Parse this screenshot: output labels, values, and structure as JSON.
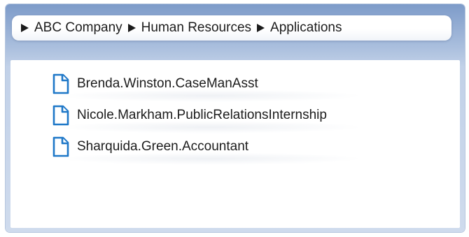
{
  "breadcrumb": {
    "items": [
      {
        "label": "ABC Company"
      },
      {
        "label": "Human Resources"
      },
      {
        "label": "Applications"
      }
    ]
  },
  "files": [
    {
      "name": "Brenda.Winston.CaseManAsst",
      "icon": "document-icon"
    },
    {
      "name": "Nicole.Markham.PublicRelationsInternship",
      "icon": "document-icon"
    },
    {
      "name": "Sharquida.Green.Accountant",
      "icon": "document-icon"
    }
  ],
  "colors": {
    "window_top": "#7d9bc9",
    "window_bottom": "#cfdbed",
    "icon_blue": "#1f78c8"
  }
}
